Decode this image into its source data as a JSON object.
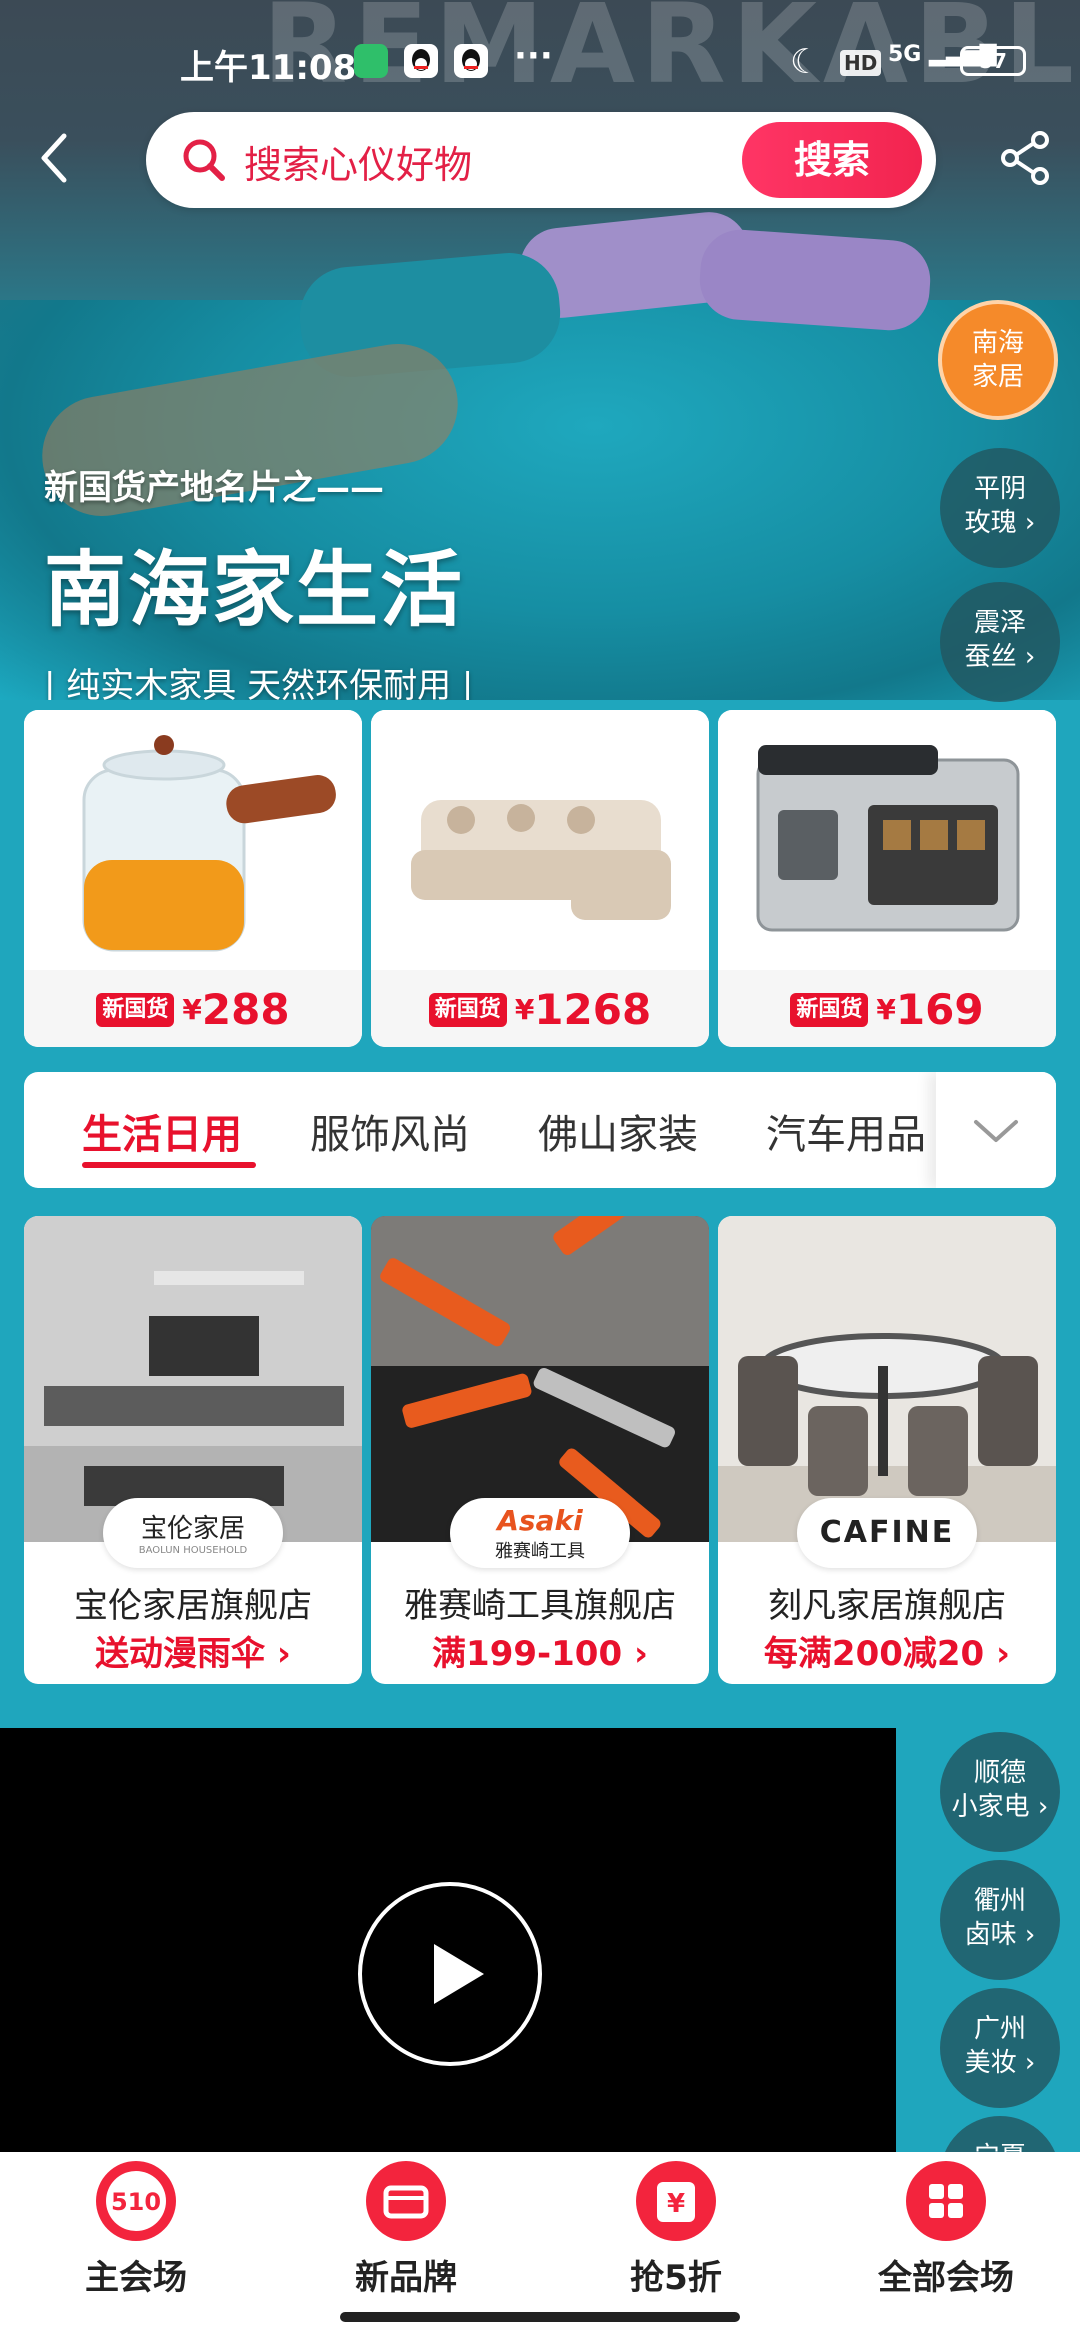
{
  "status_bar": {
    "time": "上午11:08",
    "dots": "···",
    "network": "5G",
    "hd": "HD",
    "battery": "57"
  },
  "search": {
    "placeholder": "搜索心仪好物",
    "button": "搜索"
  },
  "hero": {
    "wall_text": "REMARKABL",
    "subtitle": "新国货产地名片之——",
    "title": "南海家生活",
    "tagline": "| 纯实木家具  天然环保耐用 |"
  },
  "regions_top": [
    {
      "line1": "南海",
      "line2": "家居",
      "active": true
    },
    {
      "line1": "平阴",
      "line2": "玫瑰 ›",
      "active": false
    },
    {
      "line1": "震泽",
      "line2": "蚕丝 ›",
      "active": false
    }
  ],
  "regions_bottom": [
    {
      "line1": "顺德",
      "line2": "小家电 ›"
    },
    {
      "line1": "衢州",
      "line2": "卤味 ›"
    },
    {
      "line1": "广州",
      "line2": "美妆 ›"
    },
    {
      "line1": "宁夏",
      "line2": ""
    }
  ],
  "products": [
    {
      "badge": "新国货",
      "currency": "¥",
      "price": "288",
      "image": "glass-teapot"
    },
    {
      "badge": "新国货",
      "currency": "¥",
      "price": "1268",
      "image": "sofa"
    },
    {
      "badge": "新国货",
      "currency": "¥",
      "price": "169",
      "image": "bread-machine"
    }
  ],
  "tabs": [
    {
      "label": "生活日用",
      "active": true
    },
    {
      "label": "服饰风尚",
      "active": false
    },
    {
      "label": "佛山家装",
      "active": false
    },
    {
      "label": "汽车用品",
      "active": false
    }
  ],
  "stores": [
    {
      "logo": "宝伦家居",
      "logo_sub": "BAOLUN HOUSEHOLD",
      "name": "宝伦家居旗舰店",
      "promo": "送动漫雨伞 ›"
    },
    {
      "logo": "Asaki",
      "logo_sub": "雅赛崎工具",
      "name": "雅赛崎工具旗舰店",
      "promo": "满199-100 ›"
    },
    {
      "logo": "CAFINE",
      "logo_sub": "",
      "name": "刻凡家居旗舰店",
      "promo": "每满200减20 ›"
    }
  ],
  "bottom_nav": [
    {
      "label": "主会场",
      "icon_text": "510"
    },
    {
      "label": "新品牌",
      "icon_text": ""
    },
    {
      "label": "抢5折",
      "icon_text": "¥"
    },
    {
      "label": "全部会场",
      "icon_text": ""
    }
  ],
  "colors": {
    "accent": "#e8112d",
    "teal": "#1fa6bd",
    "region_active": "#f58a2a"
  }
}
